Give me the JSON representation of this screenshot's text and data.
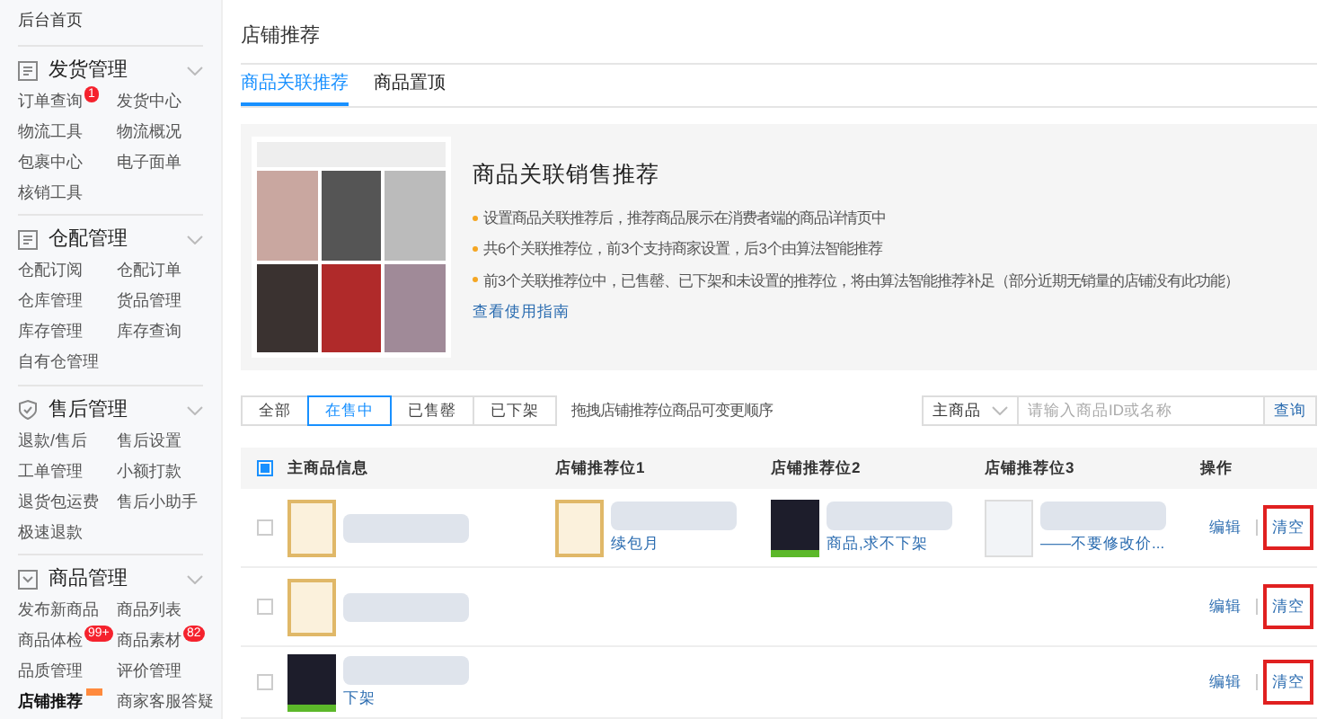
{
  "sidebar": {
    "home": "后台首页",
    "sections": [
      {
        "title": "发货管理",
        "items": [
          {
            "label": "订单查询",
            "badge": "1",
            "selected": false
          },
          {
            "label": "发货中心",
            "selected": false
          },
          {
            "label": "物流工具",
            "selected": false
          },
          {
            "label": "物流概况",
            "selected": false
          },
          {
            "label": "包裹中心",
            "selected": false
          },
          {
            "label": "电子面单",
            "selected": false
          },
          {
            "label": "核销工具",
            "selected": false
          }
        ]
      },
      {
        "title": "仓配管理",
        "items": [
          {
            "label": "仓配订阅",
            "selected": false
          },
          {
            "label": "仓配订单",
            "selected": false
          },
          {
            "label": "仓库管理",
            "selected": false
          },
          {
            "label": "货品管理",
            "selected": false
          },
          {
            "label": "库存管理",
            "selected": false
          },
          {
            "label": "库存查询",
            "selected": false
          },
          {
            "label": "自有仓管理",
            "selected": false
          }
        ]
      },
      {
        "title": "售后管理",
        "items": [
          {
            "label": "退款/售后",
            "selected": false
          },
          {
            "label": "售后设置",
            "selected": false
          },
          {
            "label": "工单管理",
            "selected": false
          },
          {
            "label": "小额打款",
            "selected": false
          },
          {
            "label": "退货包运费",
            "selected": false
          },
          {
            "label": "售后小助手",
            "selected": false
          },
          {
            "label": "极速退款",
            "selected": false
          }
        ]
      },
      {
        "title": "商品管理",
        "items": [
          {
            "label": "发布新商品",
            "selected": false
          },
          {
            "label": "商品列表",
            "selected": false
          },
          {
            "label": "商品体检",
            "badge": "99+",
            "selected": false
          },
          {
            "label": "商品素材",
            "badge": "82",
            "selected": false
          },
          {
            "label": "品质管理",
            "selected": false
          },
          {
            "label": "评价管理",
            "selected": false
          },
          {
            "label": "店铺推荐",
            "selected": true,
            "new": true
          },
          {
            "label": "商家客服答疑",
            "selected": false
          }
        ]
      }
    ]
  },
  "page_title": "店铺推荐",
  "tabs": [
    {
      "label": "商品关联推荐",
      "selected": true
    },
    {
      "label": "商品置顶",
      "selected": false
    }
  ],
  "banner": {
    "title": "商品关联销售推荐",
    "bullets": [
      "设置商品关联推荐后，推荐商品展示在消费者端的商品详情页中",
      "共6个关联推荐位，前3个支持商家设置，后3个由算法智能推荐",
      "前3个关联推荐位中，已售罄、已下架和未设置的推荐位，将由算法智能推荐补足（部分近期无销量的店铺没有此功能）"
    ],
    "link": "查看使用指南"
  },
  "filters": [
    {
      "label": "全部",
      "selected": false
    },
    {
      "label": "在售中",
      "selected": true
    },
    {
      "label": "已售罄",
      "selected": false
    },
    {
      "label": "已下架",
      "selected": false
    }
  ],
  "filter_hint": "拖拽店铺推荐位商品可变更顺序",
  "search": {
    "scope": "主商品",
    "placeholder": "请输入商品ID或名称",
    "button": "查询"
  },
  "table": {
    "header_checked": true,
    "columns": [
      "主商品信息",
      "店铺推荐位1",
      "店铺推荐位2",
      "店铺推荐位3",
      "操作"
    ],
    "rows": [
      {
        "checked": false,
        "main": {
          "kind": "card"
        },
        "slots": [
          {
            "kind": "card",
            "text": "续包月"
          },
          {
            "kind": "dark",
            "text": "商品,求不下架"
          },
          {
            "kind": "screen",
            "text": "——不要修改价..."
          }
        ],
        "actions": [
          "编辑",
          "清空"
        ],
        "highlighted": true
      },
      {
        "checked": false,
        "main": {
          "kind": "card"
        },
        "slots": [],
        "actions": [
          "编辑",
          "清空"
        ],
        "highlighted": true
      },
      {
        "checked": false,
        "main": {
          "kind": "dark",
          "text": "下架"
        },
        "slots": [],
        "actions": [
          "编辑",
          "清空"
        ],
        "highlighted": true
      }
    ]
  }
}
